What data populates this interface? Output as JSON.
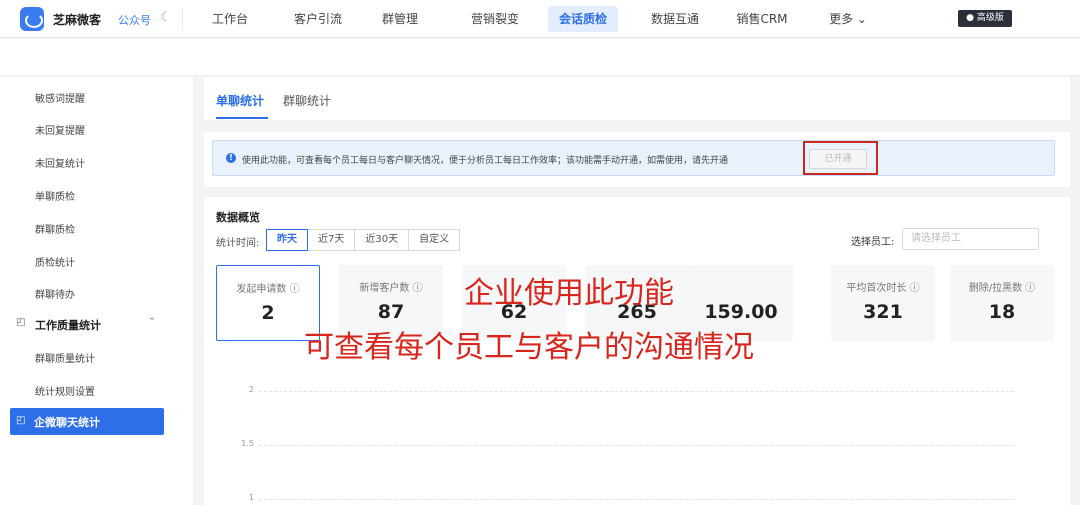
{
  "header": {
    "brand": "芝麻微客",
    "account": "公众号",
    "nav": [
      "工作台",
      "客户引流",
      "群管理",
      "营销裂变",
      "会话质检",
      "数据互通",
      "销售CRM",
      "更多 ⌄"
    ],
    "active_nav": "会话质检",
    "badge": "高级版"
  },
  "sidebar": {
    "items": [
      "敏感词提醒",
      "未回复提醒",
      "未回复统计",
      "单聊质检",
      "群聊质检",
      "质检统计",
      "群聊待办"
    ],
    "group": "工作质量统计",
    "sub_items": [
      "群聊质量统计",
      "统计规则设置"
    ],
    "active": "企微聊天统计"
  },
  "tabs": [
    "单聊统计",
    "群聊统计"
  ],
  "notice": {
    "text": "使用此功能，可查看每个员工每日与客户聊天情况，便于分析员工每日工作效率；该功能需手动开通，如需使用，请先开通",
    "button": "已开通"
  },
  "overview": {
    "title": "数据概览",
    "range_label": "统计时间:",
    "ranges": [
      "昨天",
      "近7天",
      "近30天",
      "自定义"
    ],
    "active_range": "昨天",
    "staff_label": "选择员工:",
    "staff_placeholder": "请选择员工"
  },
  "metrics": [
    {
      "label": "发起申请数 ⓘ",
      "value": "2"
    },
    {
      "label": "新增客户数 ⓘ",
      "value": "87"
    },
    {
      "label": "",
      "value": "62"
    },
    {
      "label": "",
      "value": "265"
    },
    {
      "label": "",
      "value": "159.00"
    },
    {
      "label": "平均首次时长 ⓘ",
      "value": "321"
    },
    {
      "label": "删除/拉黑数 ⓘ",
      "value": "18"
    }
  ],
  "overlay": {
    "line1": "企业使用此功能",
    "line2": "可查看每个员工与客户的沟通情况"
  },
  "chart_axis": {
    "ticks": [
      "2",
      "1.5",
      "1"
    ]
  }
}
